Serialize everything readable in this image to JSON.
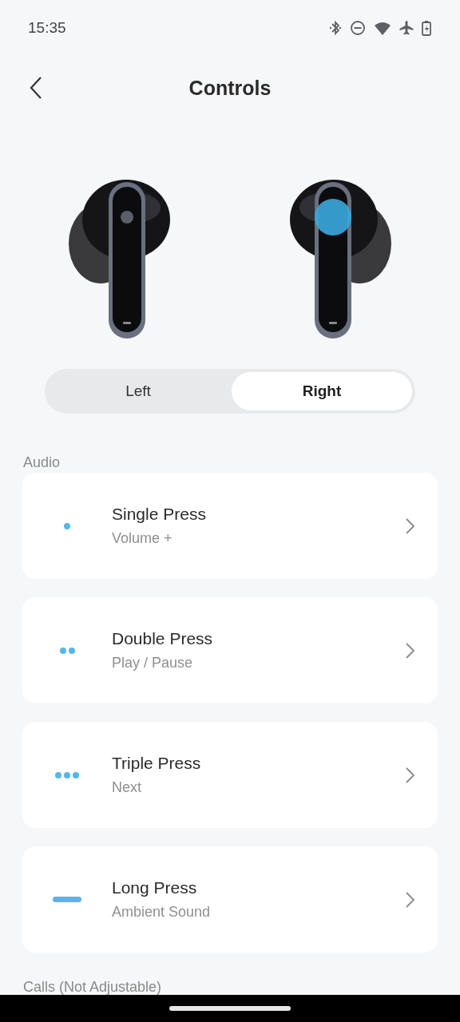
{
  "status_bar": {
    "time": "15:35"
  },
  "header": {
    "title": "Controls"
  },
  "sides": [
    {
      "label": "Left",
      "selected": false
    },
    {
      "label": "Right",
      "selected": true
    }
  ],
  "sections": [
    {
      "title": "Audio",
      "items": [
        {
          "kind": "single",
          "title": "Single Press",
          "value": "Volume +"
        },
        {
          "kind": "double",
          "title": "Double Press",
          "value": "Play / Pause"
        },
        {
          "kind": "triple",
          "title": "Triple Press",
          "value": "Next"
        },
        {
          "kind": "long",
          "title": "Long Press",
          "value": "Ambient Sound"
        }
      ]
    },
    {
      "title": "Calls (Not Adjustable)"
    }
  ]
}
